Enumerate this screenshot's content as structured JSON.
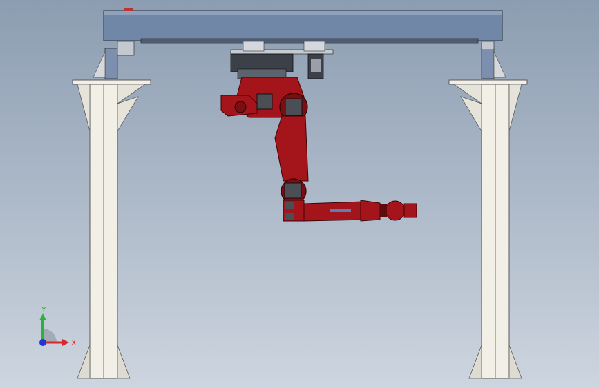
{
  "viewport": {
    "background_top": "#8c9db1",
    "background_bottom": "#cdd5df"
  },
  "colors": {
    "frame": "#f1efe6",
    "frame_outline": "#5a5a5a",
    "beam": "#6f85a6",
    "robot": "#a3151a",
    "robot_dark": "#5e0b0e",
    "mount": "#3c4048"
  },
  "triad": {
    "y_label": "Y",
    "x_label": "X",
    "y_color": "#2bb23b",
    "x_color": "#d8262b",
    "z_color": "#2333d6"
  }
}
